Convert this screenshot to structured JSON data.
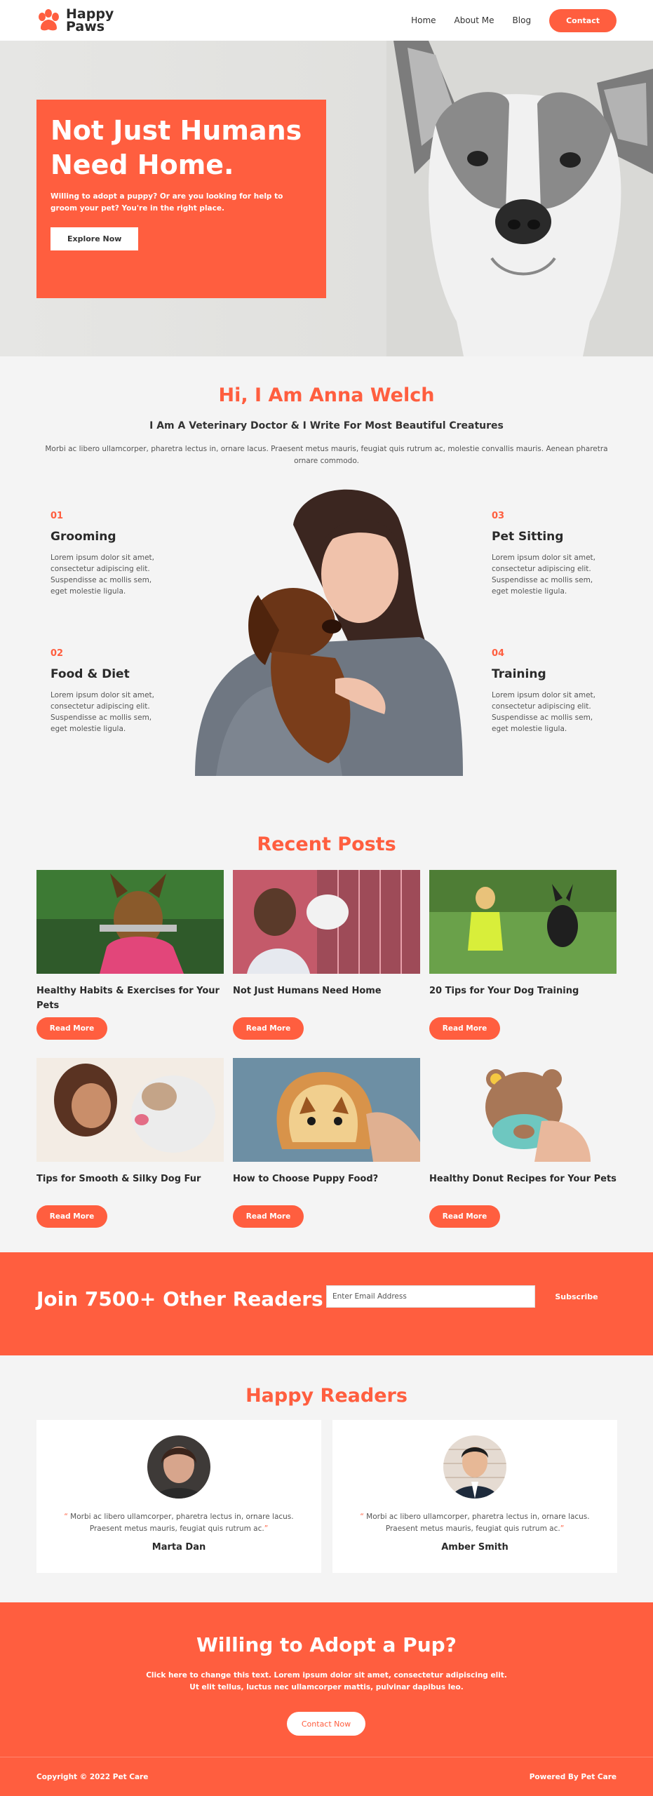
{
  "colors": {
    "accent": "#ff5e3f",
    "background": "#f4f4f4",
    "text": "#2a2a2a"
  },
  "header": {
    "logo_text": "Happy\nPaws",
    "logo_icon": "paw-icon",
    "nav": [
      {
        "label": "Home"
      },
      {
        "label": "About Me"
      },
      {
        "label": "Blog"
      }
    ],
    "contact_label": "Contact"
  },
  "hero": {
    "title": "Not Just Humans Need Home.",
    "subtitle": "Willing to adopt a puppy? Or are you looking for help to groom your pet? You're in the right place.",
    "button_label": "Explore Now"
  },
  "about": {
    "heading": "Hi, I Am Anna Welch",
    "subheading": "I Am A Veterinary Doctor & I Write For Most Beautiful Creatures",
    "lead": "Morbi ac libero ullamcorper, pharetra lectus in, ornare lacus. Praesent metus mauris, feugiat quis rutrum ac, molestie convallis mauris. Aenean pharetra ornare commodo.",
    "services": [
      {
        "num": "01",
        "title": "Grooming",
        "desc": "Lorem ipsum dolor sit amet, consectetur adipiscing elit. Suspendisse ac mollis sem, eget molestie ligula."
      },
      {
        "num": "02",
        "title": "Food & Diet",
        "desc": "Lorem ipsum dolor sit amet, consectetur adipiscing elit. Suspendisse ac mollis sem, eget molestie ligula."
      },
      {
        "num": "03",
        "title": "Pet Sitting",
        "desc": "Lorem ipsum dolor sit amet, consectetur adipiscing elit. Suspendisse ac mollis sem, eget molestie ligula."
      },
      {
        "num": "04",
        "title": "Training",
        "desc": "Lorem ipsum dolor sit amet, consectetur adipiscing elit. Suspendisse ac mollis sem, eget molestie ligula."
      }
    ]
  },
  "posts": {
    "heading": "Recent Posts",
    "read_more": "Read More",
    "items": [
      {
        "title": "Healthy Habits & Exercises for Your Pets"
      },
      {
        "title": "Not Just Humans Need Home"
      },
      {
        "title": "20 Tips for Your Dog Training"
      },
      {
        "title": "Tips for Smooth & Silky Dog Fur"
      },
      {
        "title": "How to Choose Puppy Food?"
      },
      {
        "title": "Healthy Donut Recipes for Your Pets"
      }
    ]
  },
  "subscribe": {
    "title": "Join 7500+ Other Readers",
    "placeholder": "Enter Email Address",
    "button_label": "Subscribe"
  },
  "readers": {
    "heading": "Happy Readers",
    "items": [
      {
        "quote": "Morbi ac libero ullamcorper, pharetra lectus in, ornare lacus. Praesent metus mauris, feugiat quis rutrum ac.",
        "name": "Marta Dan"
      },
      {
        "quote": "Morbi ac libero ullamcorper, pharetra lectus in, ornare lacus. Praesent metus mauris, feugiat quis rutrum ac.",
        "name": "Amber Smith"
      }
    ]
  },
  "cta": {
    "title": "Willing to Adopt a Pup?",
    "text": "Click here to change this text. Lorem ipsum dolor sit amet, consectetur adipiscing elit.\nUt elit tellus, luctus nec ullamcorper mattis, pulvinar dapibus leo.",
    "button_label": "Contact Now"
  },
  "footer": {
    "copyright": "Copyright © 2022 Pet Care",
    "powered": "Powered By Pet Care"
  }
}
